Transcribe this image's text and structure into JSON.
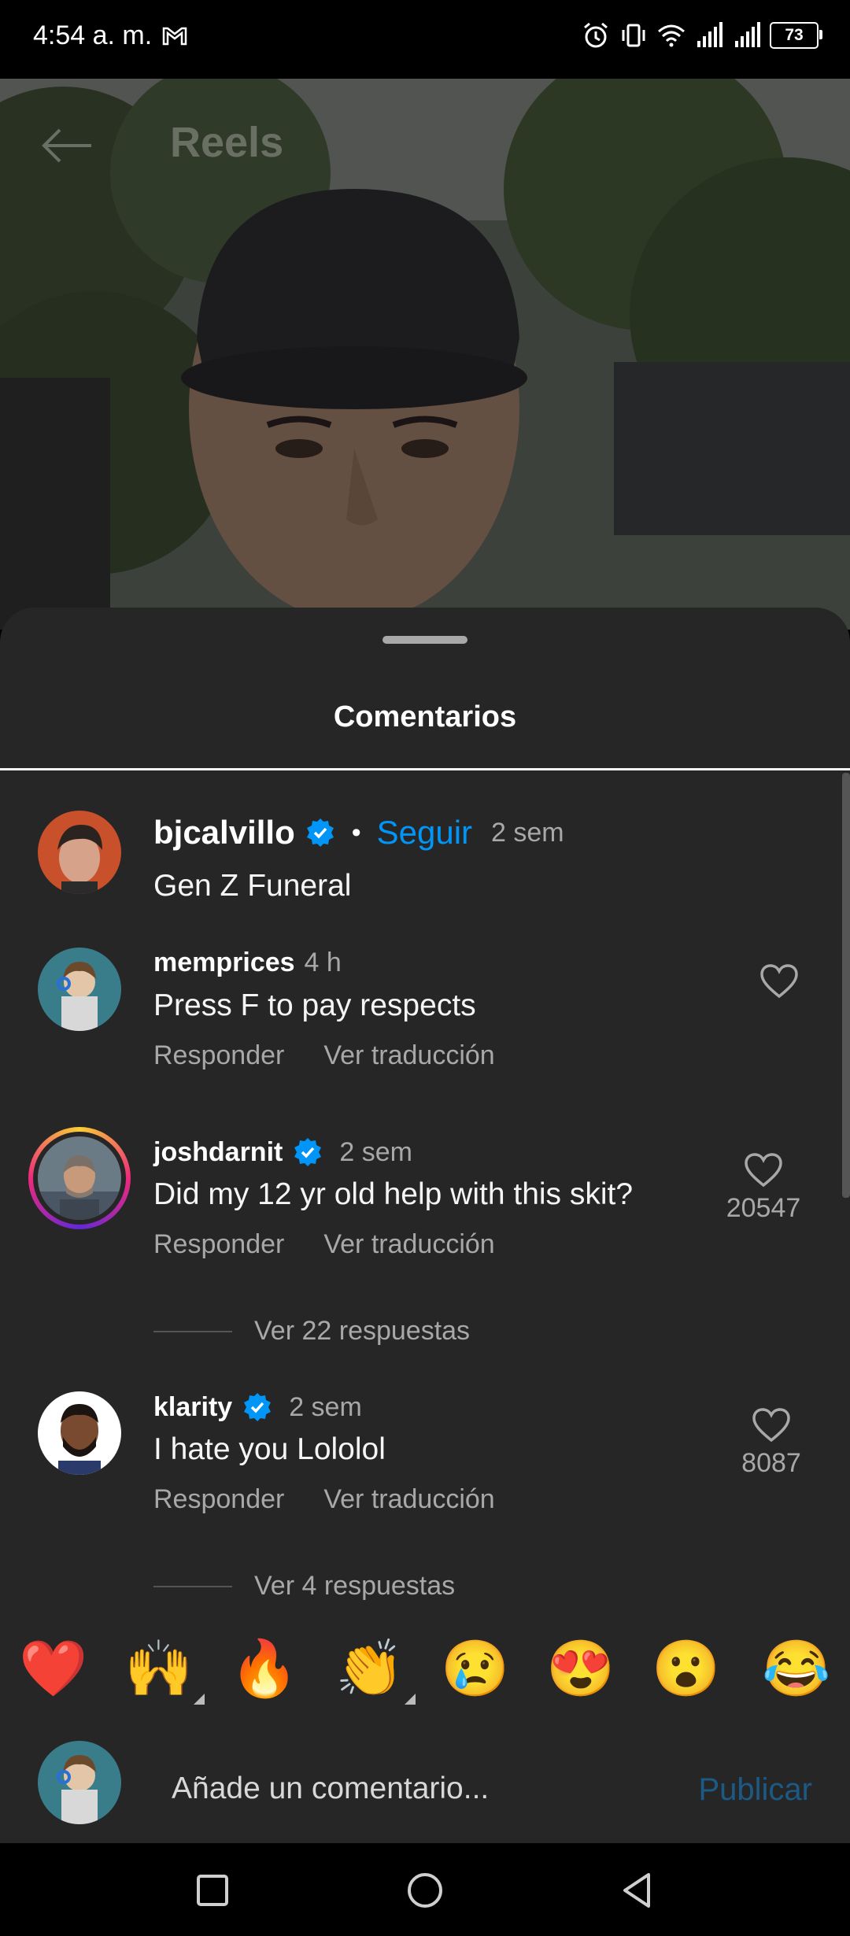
{
  "status_bar": {
    "time": "4:54 a. m.",
    "battery": "73"
  },
  "header": {
    "title": "Reels"
  },
  "sheet": {
    "title": "Comentarios"
  },
  "caption": {
    "username": "bjcalvillo",
    "follow_label": "Seguir",
    "time": "2 sem",
    "text": "Gen Z Funeral"
  },
  "comments": [
    {
      "username": "memprices",
      "time": "4 h",
      "text": "Press F to pay respects",
      "reply_label": "Responder",
      "translate_label": "Ver traducción",
      "likes": ""
    },
    {
      "username": "joshdarnit",
      "time": "2 sem",
      "text": "Did my 12 yr old help with this skit?",
      "reply_label": "Responder",
      "translate_label": "Ver traducción",
      "likes": "20547",
      "replies_label": "Ver 22 respuestas"
    },
    {
      "username": "klarity",
      "time": "2 sem",
      "text": "I hate you Lololol",
      "reply_label": "Responder",
      "translate_label": "Ver traducción",
      "likes": "8087",
      "replies_label": "Ver 4 respuestas"
    }
  ],
  "emojis": [
    "❤️",
    "🙌",
    "🔥",
    "👏",
    "😢",
    "😍",
    "😮",
    "😂"
  ],
  "composer": {
    "placeholder": "Añade un comentario...",
    "publish_label": "Publicar"
  },
  "colors": {
    "accent": "#0095f6",
    "sheet_bg": "#262626",
    "muted": "#a8a8a8"
  }
}
